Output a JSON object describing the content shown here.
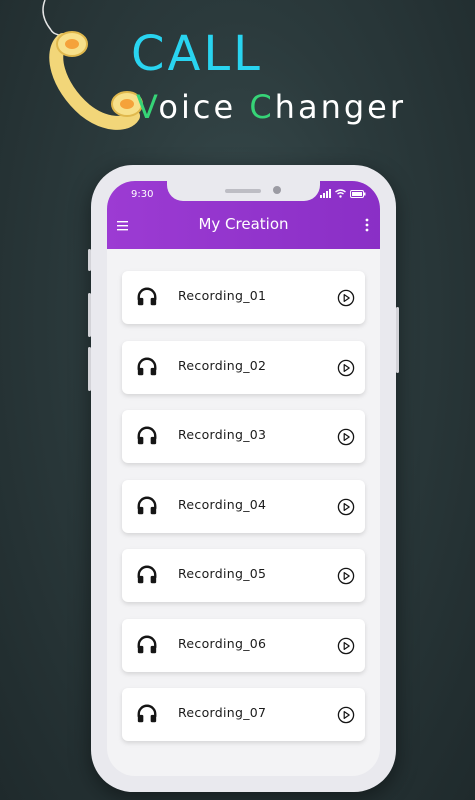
{
  "promo": {
    "title_line1": "CALL",
    "title_line2_parts": [
      "V",
      "oice ",
      "C",
      "hanger"
    ]
  },
  "device": {
    "status_time": "9:30"
  },
  "app": {
    "screen_title": "My Creation",
    "recordings": [
      {
        "name": "Recording_01"
      },
      {
        "name": "Recording_02"
      },
      {
        "name": "Recording_03"
      },
      {
        "name": "Recording_04"
      },
      {
        "name": "Recording_05"
      },
      {
        "name": "Recording_06"
      },
      {
        "name": "Recording_07"
      }
    ]
  },
  "colors": {
    "header_purple": "#9c3bd3",
    "title_cyan": "#29d4f0",
    "accent_green": "#36d477",
    "handset_yellow": "#f7e08a"
  },
  "icons": {
    "menu": "hamburger-menu-icon",
    "more": "more-vertical-icon",
    "recording": "headphones-icon",
    "play": "play-circle-icon",
    "handset": "phone-handset-icon"
  }
}
